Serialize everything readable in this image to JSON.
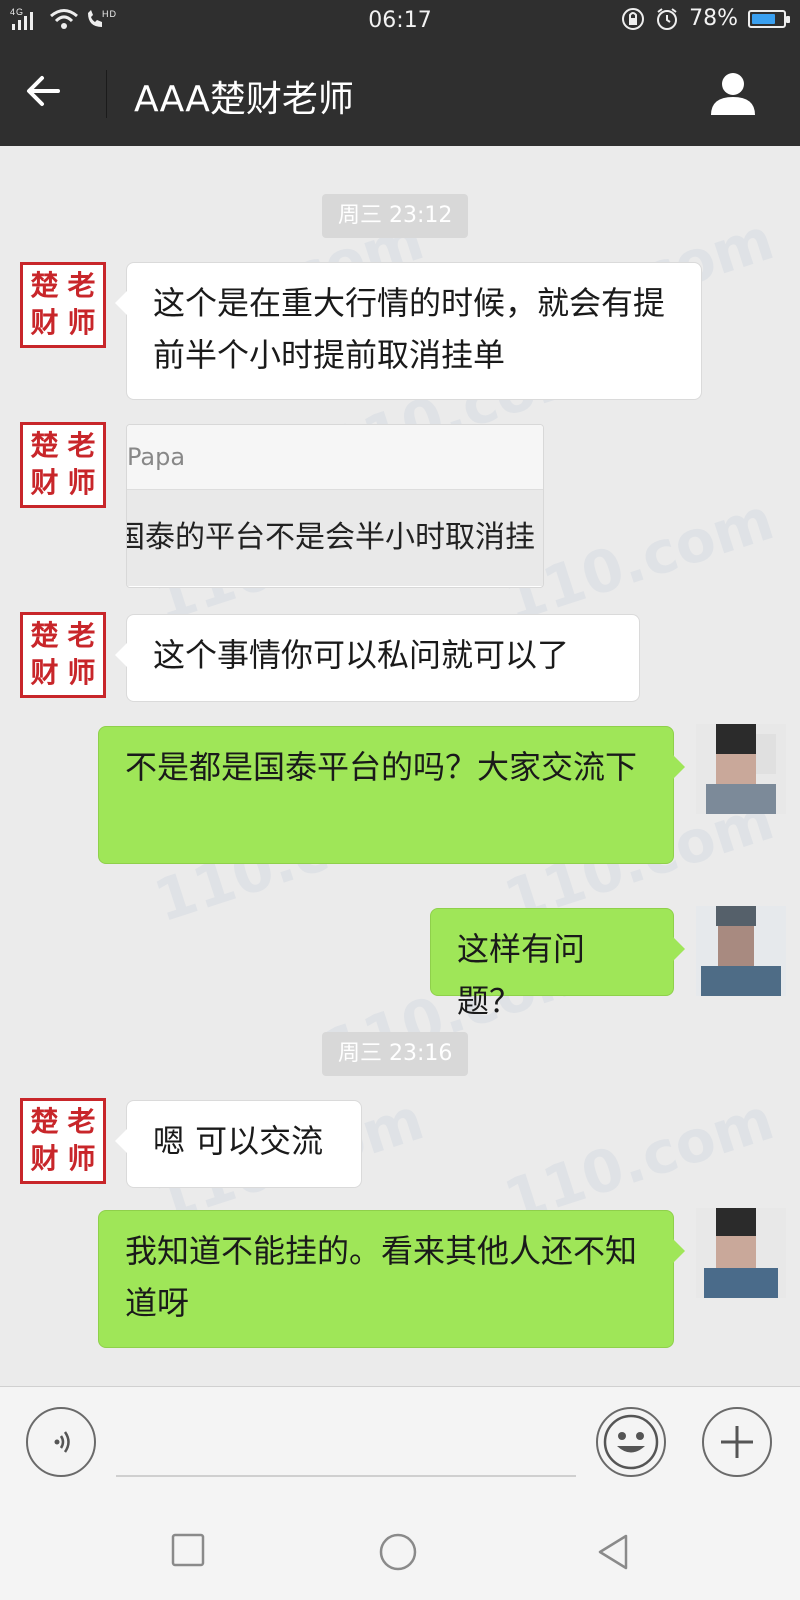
{
  "status_bar": {
    "network": "4G",
    "hd": "HD",
    "time": "06:17",
    "battery_percent": "78%",
    "battery_level": 0.78
  },
  "header": {
    "title": "AAA楚财老师",
    "back_icon": "arrow-left-icon",
    "profile_icon": "person-icon"
  },
  "avatar_teacher": {
    "chars": [
      "楚",
      "老",
      "财",
      "师"
    ]
  },
  "chat": {
    "timestamps": [
      "周三 23:12",
      "周三 23:16"
    ],
    "messages": [
      {
        "side": "left",
        "text": "这个是在重大行情的时候，就会有提前半个小时提前取消挂单"
      },
      {
        "side": "left",
        "type": "image",
        "quote_name": "Papa",
        "quote_text": "国泰的平台不是会半小时取消挂"
      },
      {
        "side": "left",
        "text": "这个事情你可以私问就可以了"
      },
      {
        "side": "right",
        "text": "不是都是国泰平台的吗？大家交流下"
      },
      {
        "side": "right",
        "text": "这样有问题？"
      },
      {
        "side": "left",
        "text": "嗯 可以交流"
      },
      {
        "side": "right",
        "text": "我知道不能挂的。看来其他人还不知道呀"
      }
    ]
  },
  "watermark": "110.com",
  "input_bar": {
    "voice_icon": "voice-icon",
    "emoji_icon": "emoji-icon",
    "plus_icon": "plus-icon"
  },
  "nav_bar": {
    "recent_icon": "square-icon",
    "home_icon": "circle-icon",
    "back_icon": "triangle-back-icon"
  }
}
